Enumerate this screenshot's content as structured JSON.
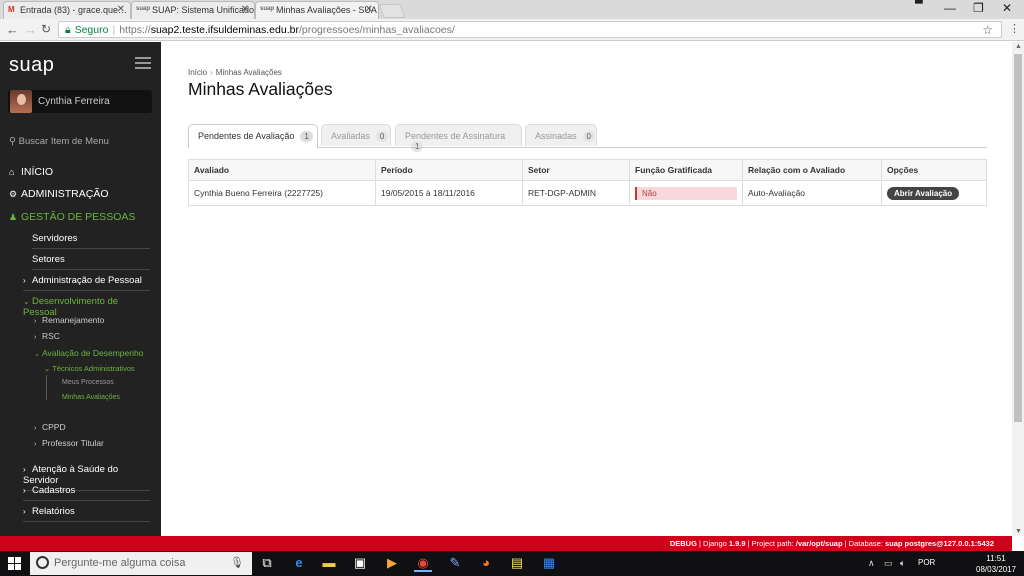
{
  "browser": {
    "tabs": [
      {
        "favicon": "M",
        "title": "Entrada (83) - grace.que…"
      },
      {
        "favicon": "suap",
        "title": "SUAP: Sistema Unificado"
      },
      {
        "favicon": "suap",
        "title": "Minhas Avaliações - SUA"
      }
    ],
    "security_label": "Seguro",
    "url_scheme": "https://",
    "url_host": "suap2.teste.ifsuldeminas.edu.br",
    "url_path": "/progressoes/minhas_avaliacoes/"
  },
  "sidebar": {
    "logo": "suap",
    "user_name": "Cynthia Ferreira",
    "search_label": "Buscar Item de Menu",
    "top_items": [
      {
        "label": "INÍCIO",
        "icon": "home-icon"
      },
      {
        "label": "ADMINISTRAÇÃO",
        "icon": "gears-icon"
      },
      {
        "label": "GESTÃO DE PESSOAS",
        "icon": "person-icon"
      }
    ],
    "level2": [
      "Servidores",
      "Setores",
      "Administração de Pessoal",
      "Desenvolvimento de Pessoal"
    ],
    "level3": [
      "Remanejamento",
      "RSC",
      "Avaliação de Desempenho",
      "CPPD",
      "Professor Titular"
    ],
    "level4": "Técnicos Administrativos",
    "level5": [
      "Meus Processos",
      "Minhas Avaliações"
    ],
    "bottom": [
      "Atenção à Saúde do Servidor",
      "Cadastros",
      "Relatórios"
    ]
  },
  "page": {
    "breadcrumb": [
      "Início",
      "Minhas Avaliações"
    ],
    "title": "Minhas Avaliações",
    "tabs": [
      {
        "label": "Pendentes de Avaliação",
        "count": "1"
      },
      {
        "label": "Avaliadas",
        "count": "0"
      },
      {
        "label": "Pendentes de Assinatura",
        "count": "1"
      },
      {
        "label": "Assinadas",
        "count": "0"
      }
    ],
    "table": {
      "headers": [
        "Avaliado",
        "Período",
        "Setor",
        "Função Gratificada",
        "Relação com o Avaliado",
        "Opções"
      ],
      "row": {
        "avaliado": "Cynthia Bueno Ferreira (2227725)",
        "periodo": "19/05/2015 à 18/11/2016",
        "setor": "RET-DGP-ADMIN",
        "funcao": "Não",
        "relacao": "Auto-Avaliação",
        "opcao": "Abrir Avaliação"
      }
    }
  },
  "debug_bar": {
    "debug": "DEBUG",
    "django_label": " | Django ",
    "django_ver": "1.9.9",
    "path_label": " | Project path: ",
    "path": "/var/opt/suap",
    "db_label": " | Database: ",
    "db": "suap postgres@127.0.0.1:5432"
  },
  "taskbar": {
    "search_placeholder": "Pergunte-me alguma coisa",
    "language": "POR",
    "time": "11:51",
    "date": "08/03/2017"
  }
}
